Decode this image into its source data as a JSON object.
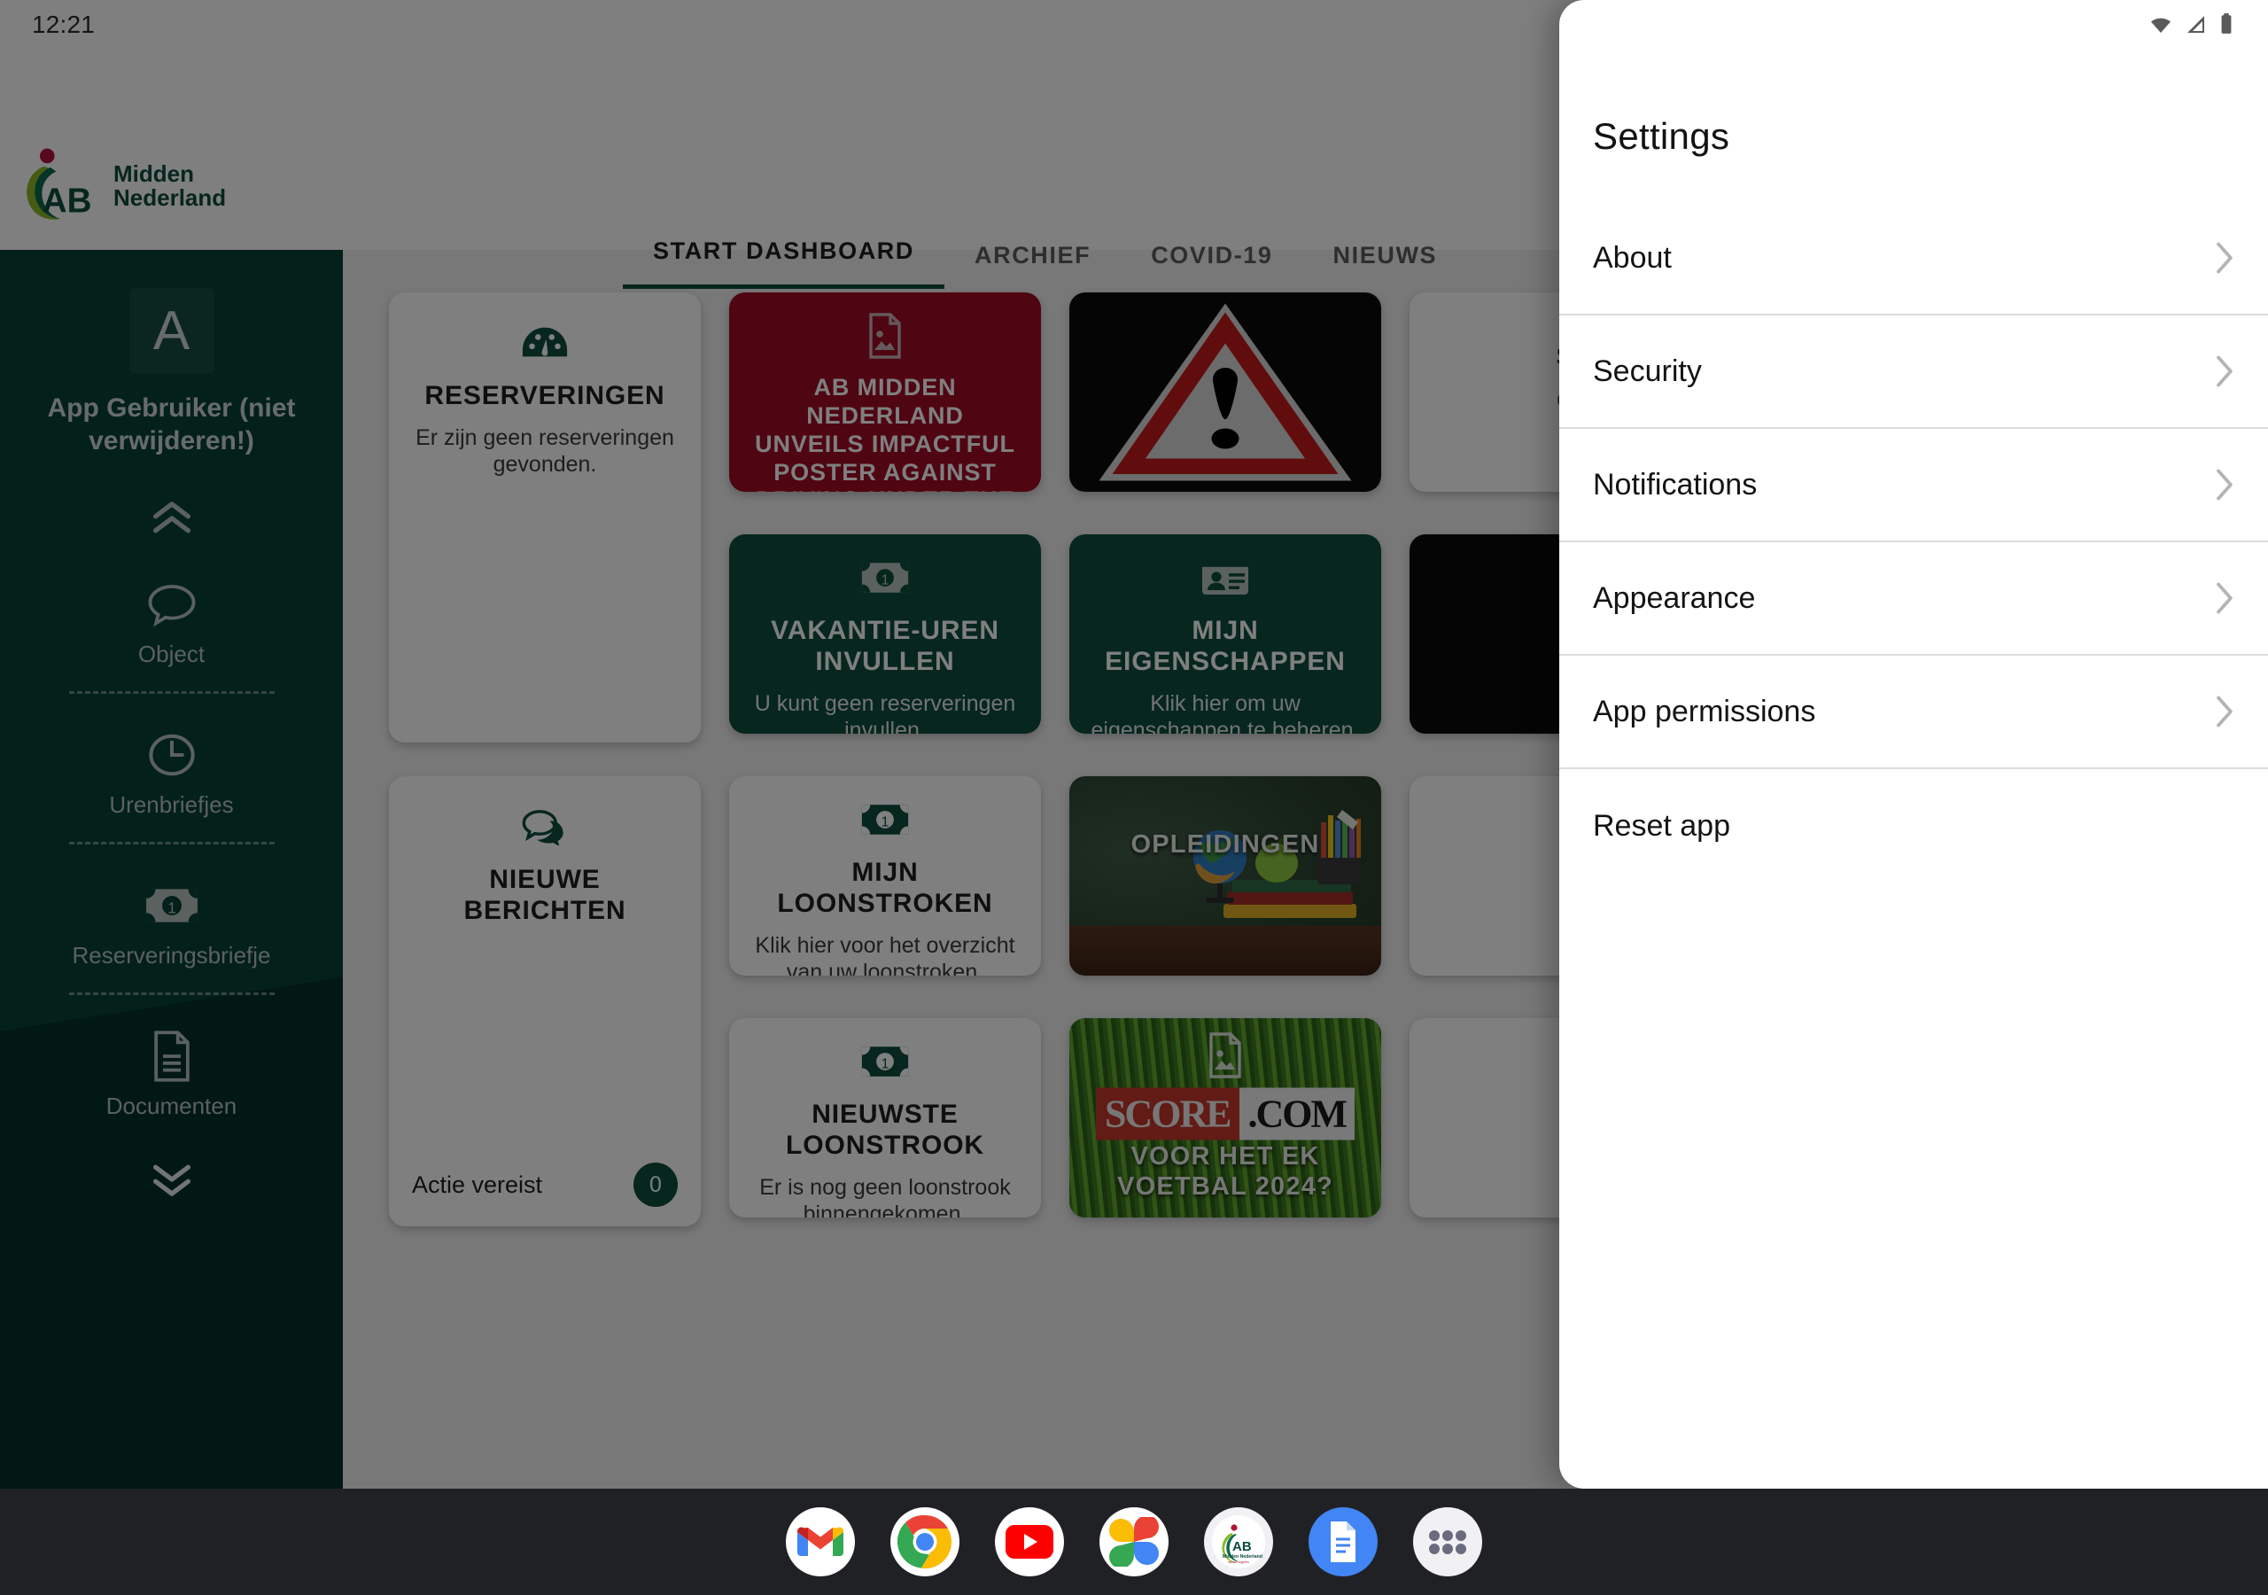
{
  "status_bar": {
    "clock": "12:21",
    "icons": [
      "wifi-icon",
      "cellular-signal-icon",
      "battery-icon"
    ]
  },
  "app": {
    "brand": {
      "logo": "ab-midden-nederland-logo",
      "line1": "Midden",
      "line2": "Nederland"
    },
    "tabs": [
      {
        "label": "START DASHBOARD",
        "active": true
      },
      {
        "label": "ARCHIEF",
        "active": false
      },
      {
        "label": "COVID-19",
        "active": false
      },
      {
        "label": "NIEUWS",
        "active": false
      }
    ]
  },
  "sidebar": {
    "avatar_initial": "A",
    "username": "App Gebruiker (niet verwijderen!)",
    "scroll_up_icon": "double-chevron-up-icon",
    "scroll_down_icon": "double-chevron-down-icon",
    "items": [
      {
        "label": "Object",
        "icon": "speech-bubble-icon"
      },
      {
        "label": "Urenbriefjes",
        "icon": "clock-icon"
      },
      {
        "label": "Reserveringsbriefje",
        "icon": "banknote-icon"
      },
      {
        "label": "Documenten",
        "icon": "document-icon"
      }
    ]
  },
  "dashboard": {
    "cards": [
      {
        "id": "reserveringen",
        "style": "white",
        "icon": "gauge-icon",
        "title": "RESERVERINGEN",
        "subtitle": "Er zijn geen reserveringen gevonden."
      },
      {
        "id": "news-poster",
        "style": "red",
        "icon": "image-placeholder-icon",
        "title": "AB MIDDEN NEDERLAND UNVEILS IMPACTFUL POSTER AGAINST DRIVING UNDER THE INFLUENCE",
        "subtitle": ""
      },
      {
        "id": "warning-news",
        "style": "dark-image",
        "icon": "warning-triangle-icon",
        "title": "",
        "subtitle": ""
      },
      {
        "id": "partial-card",
        "style": "white",
        "icon": "",
        "title": "S",
        "subtitle": "di"
      },
      {
        "id": "vakantie-uren",
        "style": "teal",
        "icon": "banknote-icon",
        "title": "VAKANTIE-UREN INVULLEN",
        "subtitle": "U kunt geen reserveringen invullen."
      },
      {
        "id": "mijn-eigenschappen",
        "style": "teal",
        "icon": "id-card-icon",
        "title": "MIJN EIGENSCHAPPEN",
        "subtitle": "Klik hier om uw eigenschappen te beheren."
      },
      {
        "id": "nieuwe-berichten",
        "style": "white",
        "icon": "chat-bubbles-icon",
        "title": "NIEUWE BERICHTEN",
        "subtitle": "",
        "footer_label": "Actie vereist",
        "badge": "0"
      },
      {
        "id": "mijn-loonstroken",
        "style": "white",
        "icon": "banknote-icon",
        "title": "MIJN LOONSTROKEN",
        "subtitle": "Klik hier voor het overzicht van uw loonstroken."
      },
      {
        "id": "opleidingen",
        "style": "image",
        "icon": "",
        "title": "OPLEIDINGEN",
        "subtitle": ""
      },
      {
        "id": "nieuwste-loonstrook",
        "style": "white",
        "icon": "banknote-icon",
        "title": "NIEUWSTE LOONSTROOK",
        "subtitle": "Er is nog geen loonstrook binnengekomen."
      },
      {
        "id": "ek-voetbal",
        "style": "image-grass",
        "icon": "image-placeholder-icon",
        "title": "VOOR HET EK VOETBAL 2024?",
        "logo_left": "SCORE",
        "logo_right": ".COM",
        "subtitle": ""
      }
    ]
  },
  "settings_panel": {
    "title": "Settings",
    "items": [
      {
        "label": "About",
        "chevron": true
      },
      {
        "label": "Security",
        "chevron": true
      },
      {
        "label": "Notifications",
        "chevron": true
      },
      {
        "label": "Appearance",
        "chevron": true
      },
      {
        "label": "App permissions",
        "chevron": true
      },
      {
        "label": "Reset app",
        "chevron": false
      }
    ]
  },
  "dock": {
    "apps": [
      {
        "name": "gmail-icon"
      },
      {
        "name": "chrome-icon"
      },
      {
        "name": "youtube-icon"
      },
      {
        "name": "google-photos-icon"
      },
      {
        "name": "ab-midden-nederland-app-icon"
      },
      {
        "name": "google-docs-icon"
      },
      {
        "name": "app-drawer-icon"
      }
    ]
  },
  "colors": {
    "brand_teal": "#0c4c3d",
    "sidebar_dark": "#064034",
    "accent_red": "#9e0b25",
    "dock_bg": "#202124"
  }
}
